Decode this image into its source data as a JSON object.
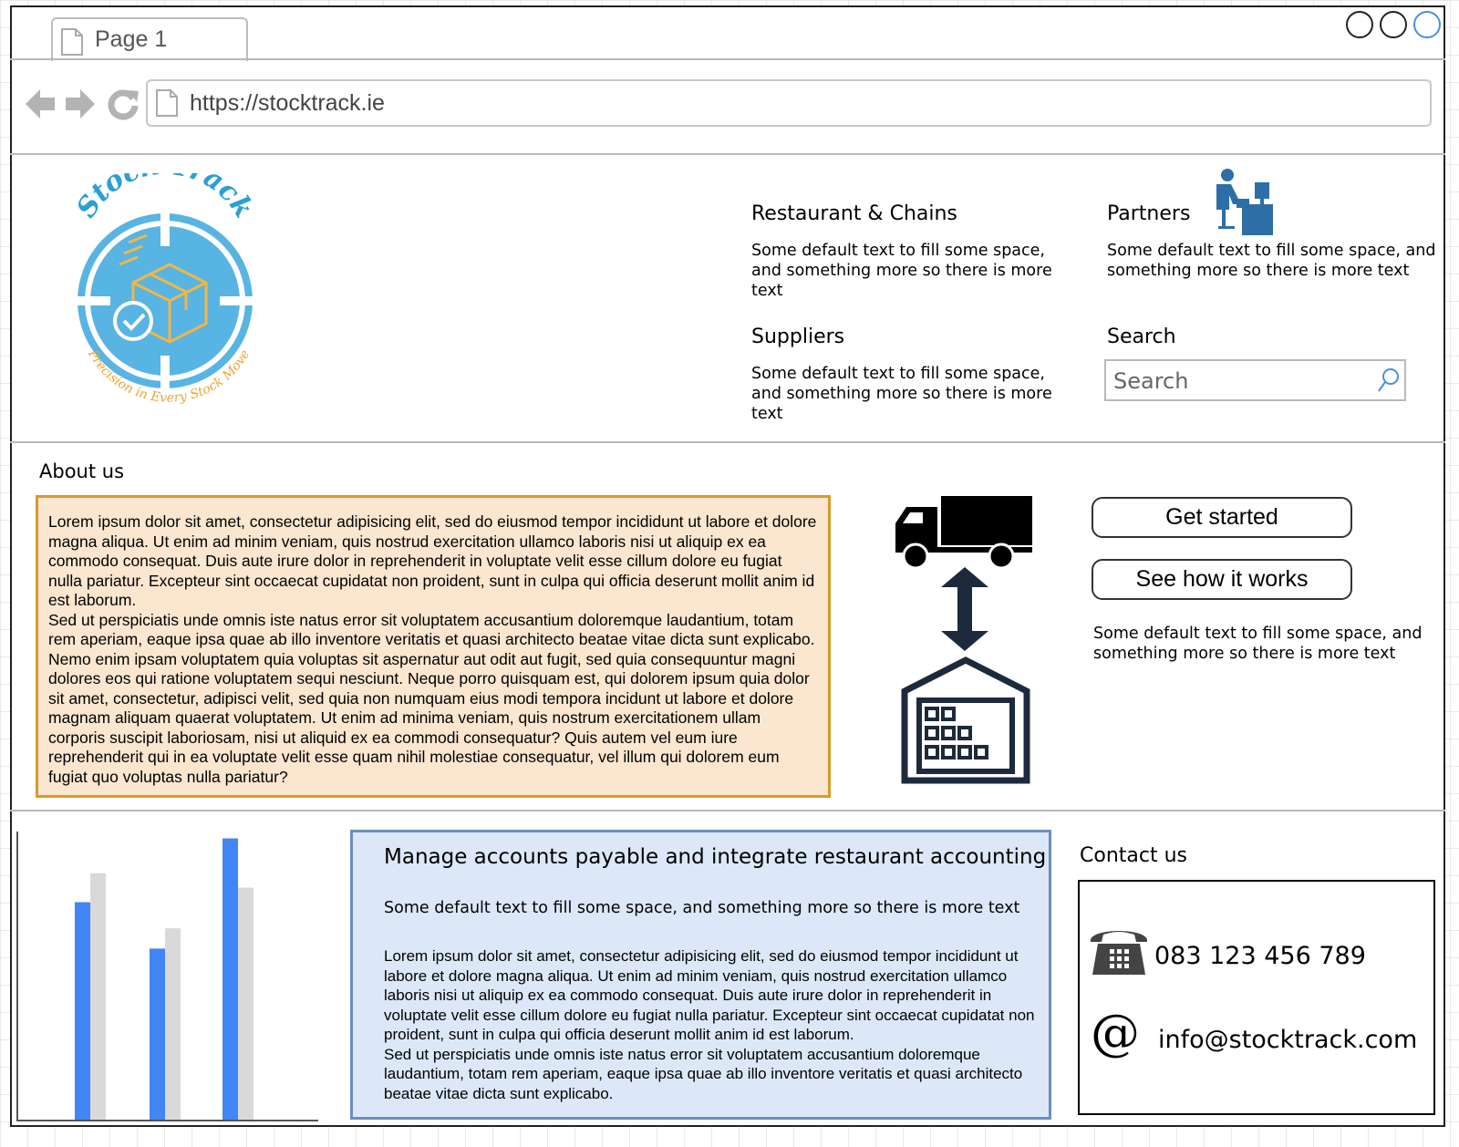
{
  "browser": {
    "tab_label": "Page 1",
    "url": "https://stocktrack.ie"
  },
  "logo": {
    "name_text": "Stock Track",
    "tagline": "Precision in Every Stock Move"
  },
  "header": {
    "sections": [
      {
        "title": "Restaurant & Chains",
        "text": "Some default text to fill some space, and something more so there is more text"
      },
      {
        "title": "Partners",
        "text": "Some default text to fill some space, and something more so there is more text"
      },
      {
        "title": "Suppliers",
        "text": "Some default text to fill some space, and something more so there is more text"
      }
    ],
    "search": {
      "title": "Search",
      "placeholder": "Search"
    }
  },
  "about": {
    "title": "About us",
    "paragraphs": [
      "Lorem ipsum dolor sit amet, consectetur adipisicing elit, sed do eiusmod tempor incididunt ut labore et dolore magna aliqua. Ut enim ad minim veniam, quis nostrud exercitation ullamco laboris nisi ut aliquip ex ea commodo consequat. Duis aute irure dolor in reprehenderit in voluptate velit esse cillum dolore eu fugiat nulla pariatur. Excepteur sint occaecat cupidatat non proident, sunt in culpa qui officia deserunt mollit anim id est laborum.",
      "Sed ut perspiciatis unde omnis iste natus error sit voluptatem accusantium doloremque laudantium, totam rem aperiam, eaque ipsa quae ab illo inventore veritatis et quasi architecto beatae vitae dicta sunt explicabo. Nemo enim ipsam voluptatem quia voluptas sit aspernatur aut odit aut fugit, sed quia consequuntur magni dolores eos qui ratione voluptatem sequi nesciunt. Neque porro quisquam est, qui dolorem ipsum quia dolor sit amet, consectetur, adipisci velit, sed quia non numquam eius modi tempora incidunt ut labore et dolore magnam aliquam quaerat voluptatem. Ut enim ad minima veniam, quis nostrum exercitationem ullam corporis suscipit laboriosam, nisi ut aliquid ex ea commodi consequatur? Quis autem vel eum iure reprehenderit qui in ea voluptate velit esse quam nihil molestiae consequatur, vel illum qui dolorem eum fugiat quo voluptas nulla pariatur?"
    ]
  },
  "cta": {
    "get_started": "Get started",
    "see_how": "See how it works",
    "text": "Some default text to fill some space, and something more so there is more text"
  },
  "chart_data": {
    "type": "bar",
    "categories": [
      "",
      "",
      ""
    ],
    "series": [
      {
        "color": "#4285f4",
        "values": [
          75,
          59,
          97
        ]
      },
      {
        "color": "#d9d9d9",
        "values": [
          85,
          66,
          80
        ]
      }
    ],
    "ylim": [
      0,
      100
    ],
    "grid": false
  },
  "manage": {
    "title": "Manage accounts payable and integrate restaurant accounting",
    "subtitle": "Some default text to fill some space, and something more so there is more text",
    "paragraphs": [
      "Lorem ipsum dolor sit amet, consectetur adipisicing elit, sed do eiusmod tempor incididunt ut labore et dolore magna aliqua. Ut enim ad minim veniam, quis nostrud exercitation ullamco laboris nisi ut aliquip ex ea commodo consequat. Duis aute irure dolor in reprehenderit in voluptate velit esse cillum dolore eu fugiat nulla pariatur. Excepteur sint occaecat cupidatat non proident, sunt in culpa qui officia deserunt mollit anim id est laborum.",
      "Sed ut perspiciatis unde omnis iste natus error sit voluptatem accusantium doloremque laudantium, totam rem aperiam, eaque ipsa quae ab illo inventore veritatis et quasi architecto beatae vitae dicta sunt explicabo."
    ]
  },
  "contact": {
    "title": "Contact us",
    "phone": "083 123 456 789",
    "email": "info@stocktrack.com"
  },
  "icons": {
    "tab": "page-icon",
    "back": "back-arrow-icon",
    "forward": "forward-arrow-icon",
    "reload": "reload-icon",
    "search": "magnifier-icon",
    "partners": "person-at-desk-icon",
    "truck": "truck-icon",
    "arrows": "double-arrow-icon",
    "warehouse": "warehouse-icon",
    "phone": "telephone-icon",
    "email": "at-sign-icon"
  }
}
